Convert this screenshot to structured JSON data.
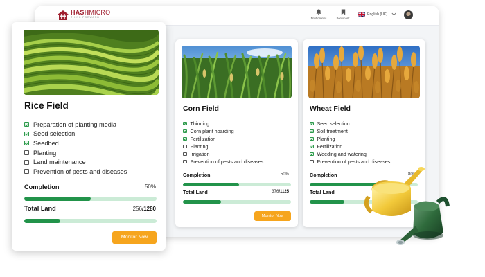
{
  "brand": {
    "name_primary": "HASH",
    "name_secondary": "MICRO",
    "tagline": "THINK FORWARD",
    "color": "#a01f2f"
  },
  "topbar": {
    "notifications_label": "Notifications",
    "bookmark_label": "Bookmark",
    "language_label": "English (UK)"
  },
  "colors": {
    "progress_fill": "#22934a",
    "progress_track": "#cbebd6",
    "button": "#f6a51d",
    "checkbox_checked": "#2e9b4c"
  },
  "cards": {
    "rice": {
      "title": "Rice Field",
      "image": "terraced-rice-field",
      "tasks": [
        {
          "label": "Preparation of planting media",
          "checked": true
        },
        {
          "label": "Seed selection",
          "checked": true
        },
        {
          "label": "Seedbed",
          "checked": true
        },
        {
          "label": "Planting",
          "checked": false
        },
        {
          "label": "Land maintenance",
          "checked": false
        },
        {
          "label": "Prevention of pests and diseases",
          "checked": false
        }
      ],
      "completion_label": "Completion",
      "completion_value": "50%",
      "completion_fraction": 0.5,
      "land_label": "Total Land",
      "land_used": "256",
      "land_total": "/1280",
      "land_fraction": 0.27,
      "button_label": "Monitor Now"
    },
    "corn": {
      "title": "Corn Field",
      "image": "corn-field",
      "tasks": [
        {
          "label": "Thinning",
          "checked": true
        },
        {
          "label": "Corn plant hoarding",
          "checked": true
        },
        {
          "label": "Fertilization",
          "checked": true
        },
        {
          "label": "Planting",
          "checked": false
        },
        {
          "label": "Irrigation",
          "checked": false
        },
        {
          "label": "Prevention of pests and diseases",
          "checked": false
        }
      ],
      "completion_label": "Completion",
      "completion_value": "50%",
      "completion_fraction": 0.52,
      "land_label": "Total Land",
      "land_used": "376",
      "land_total": "/1125",
      "land_fraction": 0.35,
      "button_label": "Monitor Now"
    },
    "wheat": {
      "title": "Wheat Field",
      "image": "wheat-field",
      "tasks": [
        {
          "label": "Seed selection",
          "checked": true
        },
        {
          "label": "Soil treatment",
          "checked": true
        },
        {
          "label": "Planting",
          "checked": true
        },
        {
          "label": "Fertilization",
          "checked": true
        },
        {
          "label": "Weeding and watering",
          "checked": true
        },
        {
          "label": "Prevention of pests and diseases",
          "checked": false
        }
      ],
      "completion_label": "Completion",
      "completion_value": "80%",
      "completion_fraction": 0.8,
      "land_label": "Total Land",
      "land_fraction": 0.32
    }
  },
  "decoration": {
    "icon": "watering-can-icon"
  }
}
